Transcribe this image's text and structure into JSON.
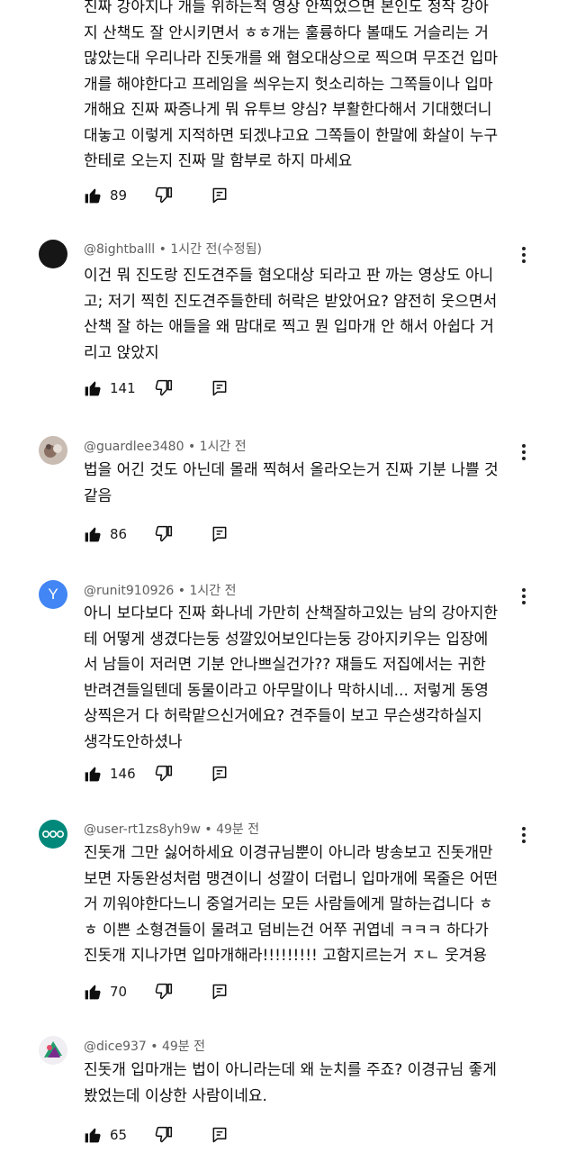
{
  "comments": [
    {
      "author": "",
      "time": "",
      "text": "진짜 강아지나 개들 위하는척 영상 안찍었으면 본인도 정작 강아\n지 산책도 잘 안시키면서 ㅎㅎ개는 훌륭하다 볼때도 거슬리는 거\n많았는대 우리나라 진돗개를 왜 혐오대상으로 찍으며 무조건 입마\n개를 해야한다고 프레임을 씌우는지 헛소리하는 그쪽들이나 입마\n개해요 진짜 짜증나게 뭐 유투브 양심? 부활한다해서 기대했더니\n대놓고 이렇게 지적하면 되겠냐고요 그쪽들이 한말에 화살이 누구\n한테로 오는지 진짜 말 함부로 하지 마세요",
      "likes": "89"
    },
    {
      "author": "@8ightballl",
      "time": "1시간 전(수정됨)",
      "text": "이건 뭐 진도랑 진도견주들 혐오대상 되라고 판 까는 영상도 아니\n고; 저기 찍힌 진도견주들한테 허락은 받았어요? 얌전히 웃으면서\n산책 잘 하는 애들을 왜 맘대로 찍고 뭔 입마개 안 해서 아쉽다 거\n리고 앉았지",
      "likes": "141"
    },
    {
      "author": "@guardlee3480",
      "time": "1시간 전",
      "text": "법을 어긴 것도 아닌데 몰래 찍혀서 올라오는거 진짜 기분 나쁠 것\n같음",
      "likes": "86"
    },
    {
      "author": "@runit910926",
      "time": "1시간 전",
      "avatar_letter": "Y",
      "text": "아니 보다보다 진짜 화나네 가만히 산책잘하고있는 남의 강아지한\n테 어떻게 생겼다는둥 성깔있어보인다는둥 강아지키우는 입장에\n서 남들이 저러면 기분 안나쁘실건가?? 쟤들도 저집에서는 귀한\n반려견들일텐데 동물이라고 아무말이나 막하시네... 저렇게 동영\n상찍은거 다 허락맡으신거에요? 견주들이 보고 무슨생각하실지\n생각도안하셨나",
      "likes": "146"
    },
    {
      "author": "@user-rt1zs8yh9w",
      "time": "49분 전",
      "text": "진돗개 그만 싫어하세요 이경규님뿐이 아니라 방송보고 진돗개만\n보면 자동완성처럼 맹견이니 성깔이 더럽니 입마개에 목줄은 어떤\n거 끼워야한다느니 중얼거리는 모든 사람들에게 말하는겁니다 ㅎ\nㅎ 이쁜 소형견들이 물려고 덤비는건 어쭈 귀엽네 ㅋㅋㅋ 하다가\n진돗개 지나가면 입마개해라!!!!!!!!! 고함지르는거 ㅈㄴ 웃겨용",
      "likes": "70"
    },
    {
      "author": "@dice937",
      "time": "49분 전",
      "text": "진돗개 입마개는 법이 아니라는데 왜 눈치를 주죠? 이경규님 좋게\n봤었는데 이상한 사람이네요.",
      "likes": "65"
    }
  ],
  "meta_separator": "•",
  "colors": {
    "text": "#0f0f0f",
    "meta": "#606060",
    "avatar_y": "#4285f4",
    "avatar_user": "#00897b"
  }
}
